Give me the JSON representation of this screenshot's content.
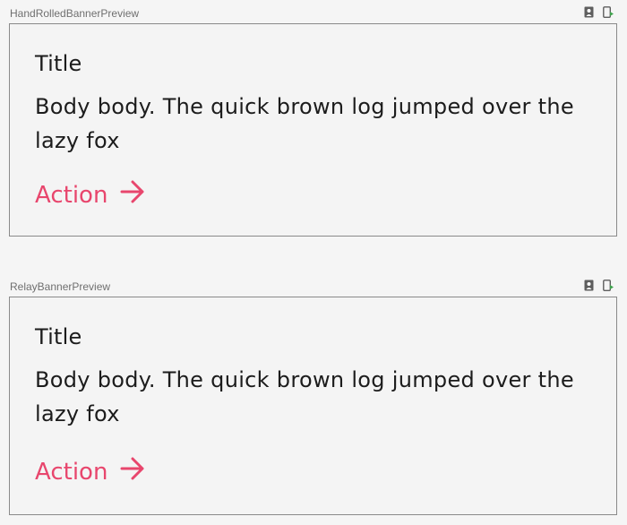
{
  "previews": [
    {
      "name": "HandRolledBannerPreview",
      "banner": {
        "title": "Title",
        "body": "Body body. The quick brown log jumped over the lazy fox",
        "action_label": "Action",
        "action_icon": "arrow-right-icon"
      }
    },
    {
      "name": "RelayBannerPreview",
      "banner": {
        "title": "Title",
        "body": "Body body. The quick brown log jumped over the lazy fox",
        "action_label": "Action",
        "action_icon": "arrow-right-icon"
      }
    }
  ],
  "toolbar_icons": [
    "interactive-mode-icon",
    "deploy-preview-icon"
  ],
  "colors": {
    "action": "#e8466d",
    "text": "#1c1c1c",
    "background": "#f5f5f5",
    "frame_border": "#8a8a8a",
    "header_text": "#6f6f6f"
  }
}
